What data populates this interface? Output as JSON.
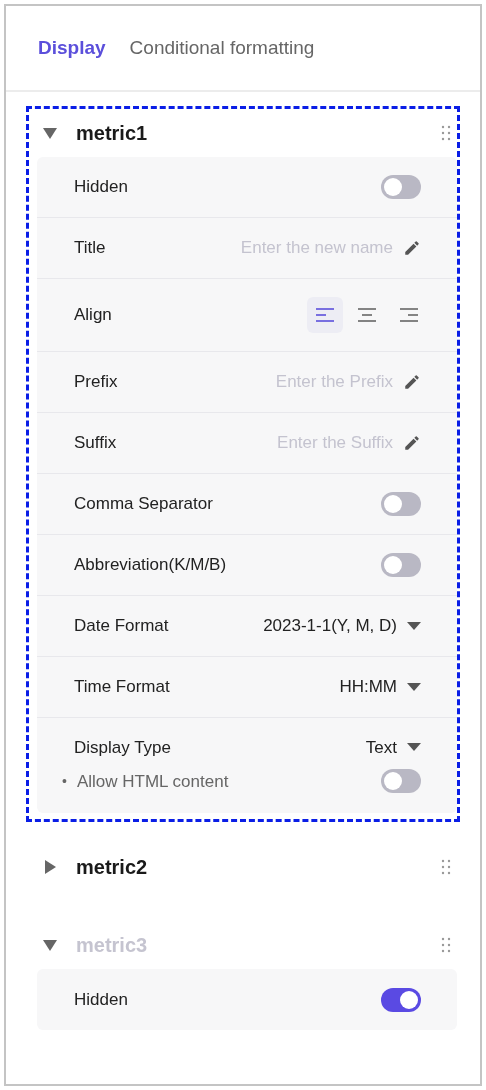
{
  "tabs": [
    {
      "label": "Display",
      "selected": true
    },
    {
      "label": "Conditional formatting",
      "selected": false
    }
  ],
  "metrics": [
    {
      "name": "metric1",
      "expanded": true,
      "highlighted": true,
      "muted": false,
      "settings": [
        {
          "kind": "toggle",
          "label": "Hidden",
          "on": false
        },
        {
          "kind": "input",
          "label": "Title",
          "placeholder": "Enter the new name"
        },
        {
          "kind": "align",
          "label": "Align",
          "options": [
            {
              "selected": true
            },
            {
              "selected": false
            },
            {
              "selected": false
            }
          ]
        },
        {
          "kind": "input",
          "label": "Prefix",
          "placeholder": "Enter the Prefix"
        },
        {
          "kind": "input",
          "label": "Suffix",
          "placeholder": "Enter the Suffix"
        },
        {
          "kind": "toggle",
          "label": "Comma Separator",
          "on": false
        },
        {
          "kind": "toggle",
          "label": "Abbreviation(K/M/B)",
          "on": false
        },
        {
          "kind": "select",
          "label": "Date Format",
          "value": "2023-1-1(Y, M, D)"
        },
        {
          "kind": "select",
          "label": "Time Format",
          "value": "HH:MM"
        },
        {
          "kind": "select",
          "label": "Display Type",
          "value": "Text",
          "sub": {
            "bullet": "•",
            "label": "Allow HTML content",
            "on": false
          }
        }
      ]
    },
    {
      "name": "metric2",
      "expanded": false,
      "highlighted": false,
      "muted": false
    },
    {
      "name": "metric3",
      "expanded": true,
      "highlighted": false,
      "muted": true,
      "settings": [
        {
          "kind": "toggle",
          "label": "Hidden",
          "on": true
        }
      ]
    }
  ]
}
